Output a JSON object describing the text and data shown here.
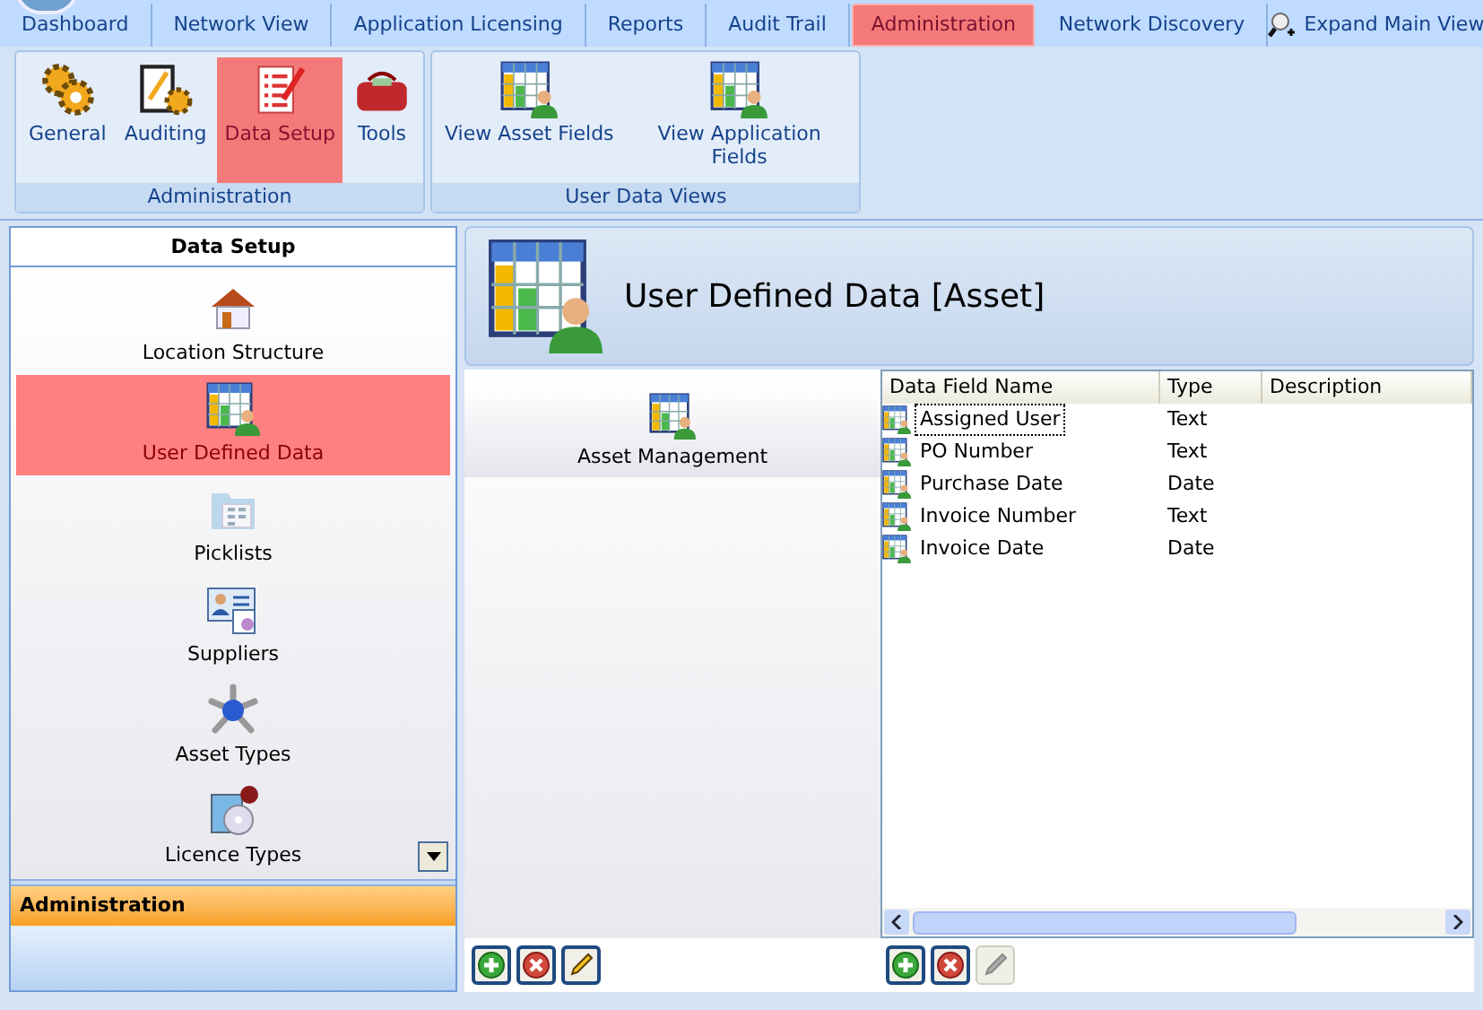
{
  "tabs": [
    {
      "label": "Dashboard",
      "selected": false
    },
    {
      "label": "Network View",
      "selected": false
    },
    {
      "label": "Application Licensing",
      "selected": false
    },
    {
      "label": "Reports",
      "selected": false
    },
    {
      "label": "Audit Trail",
      "selected": false
    },
    {
      "label": "Administration",
      "selected": true
    },
    {
      "label": "Network Discovery",
      "selected": false
    }
  ],
  "expand_button": "Expand Main View",
  "ribbon_groups": [
    {
      "title": "Administration",
      "buttons": [
        {
          "label": "General",
          "selected": false
        },
        {
          "label": "Auditing",
          "selected": false
        },
        {
          "label": "Data Setup",
          "selected": true
        },
        {
          "label": "Tools",
          "selected": false
        }
      ]
    },
    {
      "title": "User Data Views",
      "buttons": [
        {
          "label": "View Asset Fields",
          "selected": false
        },
        {
          "label": "View Application Fields",
          "selected": false
        }
      ]
    }
  ],
  "sidebar": {
    "title": "Data Setup",
    "items": [
      {
        "label": "Location Structure",
        "selected": false
      },
      {
        "label": "User Defined Data",
        "selected": true
      },
      {
        "label": "Picklists",
        "selected": false
      },
      {
        "label": "Suppliers",
        "selected": false
      },
      {
        "label": "Asset Types",
        "selected": false
      },
      {
        "label": "Licence Types",
        "selected": false
      }
    ],
    "section": "Administration"
  },
  "header": {
    "title": "User Defined Data [Asset]"
  },
  "categories": [
    {
      "label": "Asset Management",
      "selected": true
    }
  ],
  "table": {
    "columns": [
      "Data Field Name",
      "Type",
      "Description"
    ],
    "rows": [
      {
        "name": "Assigned User",
        "type": "Text",
        "selected": true
      },
      {
        "name": "PO Number",
        "type": "Text",
        "selected": false
      },
      {
        "name": "Purchase Date",
        "type": "Date",
        "selected": false
      },
      {
        "name": "Invoice Number",
        "type": "Text",
        "selected": false
      },
      {
        "name": "Invoice Date",
        "type": "Date",
        "selected": false
      }
    ]
  },
  "left_actions": [
    {
      "kind": "add",
      "disabled": false
    },
    {
      "kind": "delete",
      "disabled": false
    },
    {
      "kind": "edit",
      "disabled": false
    }
  ],
  "right_actions": [
    {
      "kind": "add",
      "disabled": false
    },
    {
      "kind": "delete",
      "disabled": false
    },
    {
      "kind": "edit",
      "disabled": true
    }
  ]
}
